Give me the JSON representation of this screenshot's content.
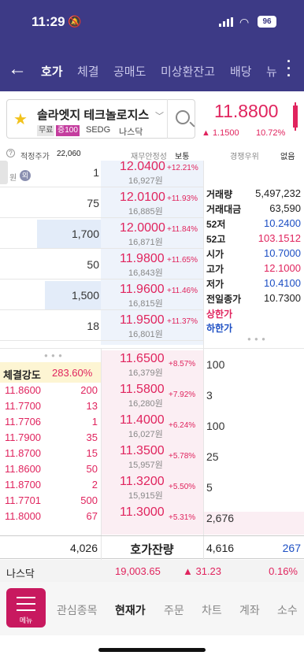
{
  "status": {
    "time": "11:29",
    "battery": "96"
  },
  "nav": {
    "tabs": [
      "호가",
      "체결",
      "공매도",
      "미상환잔고",
      "배당",
      "뉴"
    ],
    "active": "호가"
  },
  "stock": {
    "name": "솔라엣지 테크놀로지스",
    "tag_free": "무료",
    "tag_margin": "증100",
    "ticker": "SEDG",
    "market": "나스닥",
    "price": "11.8800",
    "change": "▲ 1.1500",
    "change_pct": "10.72%"
  },
  "infobar": {
    "fair_label": "적정주가",
    "fair_value": "22,060",
    "fin_label": "재무안정성",
    "fin_value": "보통",
    "comp_label": "경쟁우위",
    "comp_value": "없음"
  },
  "asks": [
    {
      "qty": "1",
      "price": "12.0400",
      "krw": "16,927원",
      "pct": "+12.21%"
    },
    {
      "qty": "75",
      "price": "12.0100",
      "krw": "16,885원",
      "pct": "+11.93%"
    },
    {
      "qty": "1,700",
      "price": "12.0000",
      "krw": "16,871원",
      "pct": "+11.84%"
    },
    {
      "qty": "50",
      "price": "11.9800",
      "krw": "16,843원",
      "pct": "+11.65%"
    },
    {
      "qty": "1,500",
      "price": "11.9600",
      "krw": "16,815원",
      "pct": "+11.46%"
    },
    {
      "qty": "18",
      "price": "11.9500",
      "krw": "16,801원",
      "pct": "+11.37%"
    }
  ],
  "ask_label": {
    "won": "원",
    "circle": "외"
  },
  "ask_fill": [
    0.01,
    0.04,
    0.66,
    0.03,
    0.58,
    0.01
  ],
  "stats": [
    {
      "label": "거래량",
      "value": "5,497,232",
      "color": "#222"
    },
    {
      "label": "거래대금",
      "value": "63,590",
      "color": "#222"
    },
    {
      "label": "52저",
      "value": "10.2400",
      "color": "#1d4fc4"
    },
    {
      "label": "52고",
      "value": "103.1512",
      "color": "#e0245e"
    },
    {
      "label": "시가",
      "value": "10.7000",
      "color": "#1d4fc4"
    },
    {
      "label": "고가",
      "value": "12.1000",
      "color": "#e0245e"
    },
    {
      "label": "저가",
      "value": "10.4100",
      "color": "#1d4fc4"
    },
    {
      "label": "전일종가",
      "value": "10.7300",
      "color": "#222"
    }
  ],
  "limits": {
    "upper": "상한가",
    "lower": "하한가"
  },
  "strength": {
    "label": "체결강도",
    "value": "283.60%"
  },
  "ticks": [
    {
      "price": "11.8600",
      "qty": "200"
    },
    {
      "price": "11.7700",
      "qty": "13"
    },
    {
      "price": "11.7706",
      "qty": "1"
    },
    {
      "price": "11.7900",
      "qty": "35"
    },
    {
      "price": "11.8700",
      "qty": "15"
    },
    {
      "price": "11.8600",
      "qty": "50"
    },
    {
      "price": "11.8700",
      "qty": "2"
    },
    {
      "price": "11.7701",
      "qty": "500"
    },
    {
      "price": "11.8000",
      "qty": "67"
    }
  ],
  "bids": [
    {
      "price": "11.6500",
      "krw": "16,379원",
      "pct": "+8.57%",
      "qty": "100"
    },
    {
      "price": "11.5800",
      "krw": "16,280원",
      "pct": "+7.92%",
      "qty": "3"
    },
    {
      "price": "11.4000",
      "krw": "16,027원",
      "pct": "+6.24%",
      "qty": "100"
    },
    {
      "price": "11.3500",
      "krw": "15,957원",
      "pct": "+5.78%",
      "qty": "25"
    },
    {
      "price": "11.3200",
      "krw": "15,915원",
      "pct": "+5.50%",
      "qty": "5"
    },
    {
      "price": "11.3000",
      "krw": "",
      "pct": "+5.31%",
      "qty": "2,676"
    }
  ],
  "totals": {
    "ask_total": "4,026",
    "label": "호가잔량",
    "bid_total": "4,616",
    "diff": "267"
  },
  "index": {
    "name": "나스닥",
    "value": "19,003.65",
    "change": "▲ 31.23",
    "pct": "0.16%"
  },
  "bottom": {
    "menu": "메뉴",
    "tabs": [
      "관심종목",
      "현재가",
      "주문",
      "차트",
      "계좌",
      "소수"
    ],
    "active": "현재가"
  }
}
